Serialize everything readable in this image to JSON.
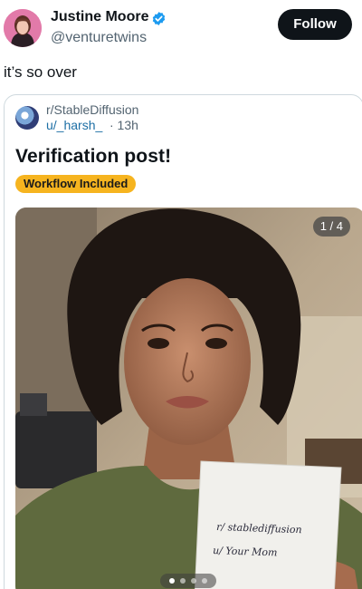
{
  "author": {
    "display_name": "Justine Moore",
    "handle": "@venturetwins",
    "verified_icon": "verified-badge-icon",
    "verified_color": "#1d9bf0"
  },
  "follow_label": "Follow",
  "tweet_text": "it’s so over",
  "embedded_post": {
    "subreddit": "r/StableDiffusion",
    "user": "u/_harsh_",
    "time": "· 13h",
    "title": "Verification post!",
    "flair": "Workflow Included",
    "flair_color": "#f6b41f",
    "media": {
      "counter": "1 / 4",
      "page_current": 1,
      "page_total": 4,
      "sign_line1": "r/ stablediffusion",
      "sign_line2": "u/ Your Mom"
    }
  }
}
